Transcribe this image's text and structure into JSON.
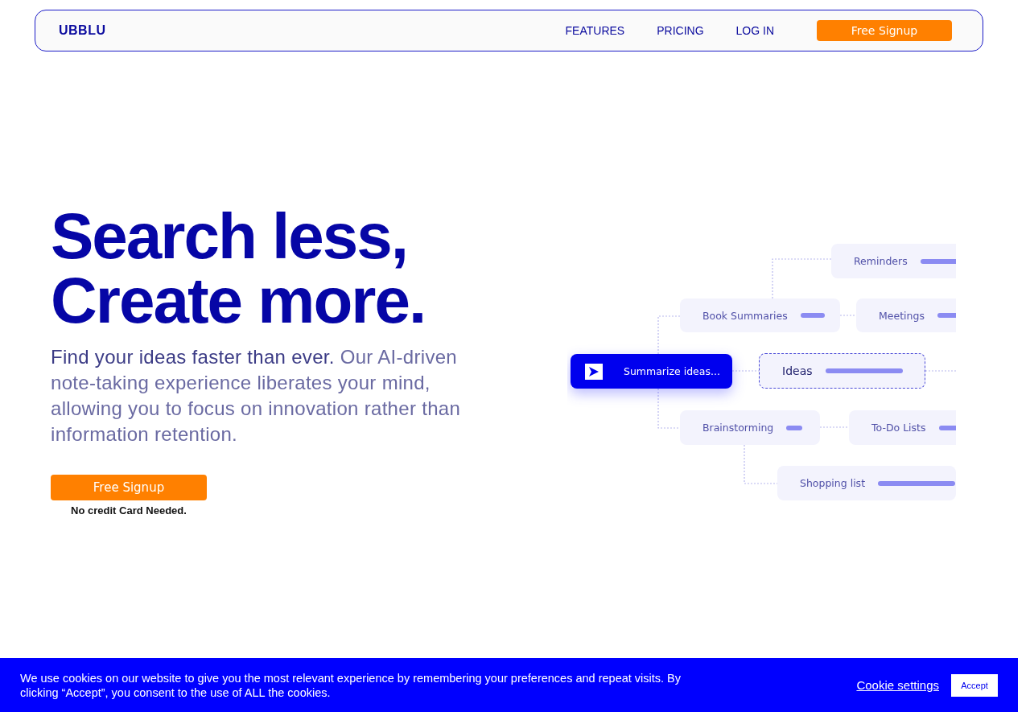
{
  "navbar": {
    "logo": "UBBLU",
    "links": [
      "FEATURES",
      "PRICING",
      "LOG IN"
    ],
    "cta": "Free Signup"
  },
  "hero": {
    "headline": [
      "Search less,",
      "Create more."
    ],
    "subtitle": "**Find your ideas faster than ever.** Our AI-driven note-taking experience liberates your mind, allowing you to focus on innovation rather than information retention.",
    "cta": "Free Signup",
    "note": "No credit Card Needed."
  },
  "mind_map": {
    "nodes": [
      {
        "label": "Reminders",
        "kind": "topic"
      },
      {
        "label": "Book Summaries",
        "kind": "topic"
      },
      {
        "label": "Meetings",
        "kind": "topic"
      },
      {
        "label": "Summarize ideas...",
        "kind": "action"
      },
      {
        "label": "Ideas",
        "kind": "focus"
      },
      {
        "label": "Brainstorming",
        "kind": "topic"
      },
      {
        "label": "To-Do Lists",
        "kind": "topic"
      },
      {
        "label": "Shopping list",
        "kind": "topic"
      }
    ]
  },
  "cookie_banner": {
    "text": "We use cookies on our website to give you the most relevant experience by remembering your preferences and repeat visits. By clicking “Accept”, you consent to the use of ALL the cookies.",
    "settings_link": "Cookie settings",
    "accept": "Accept"
  }
}
